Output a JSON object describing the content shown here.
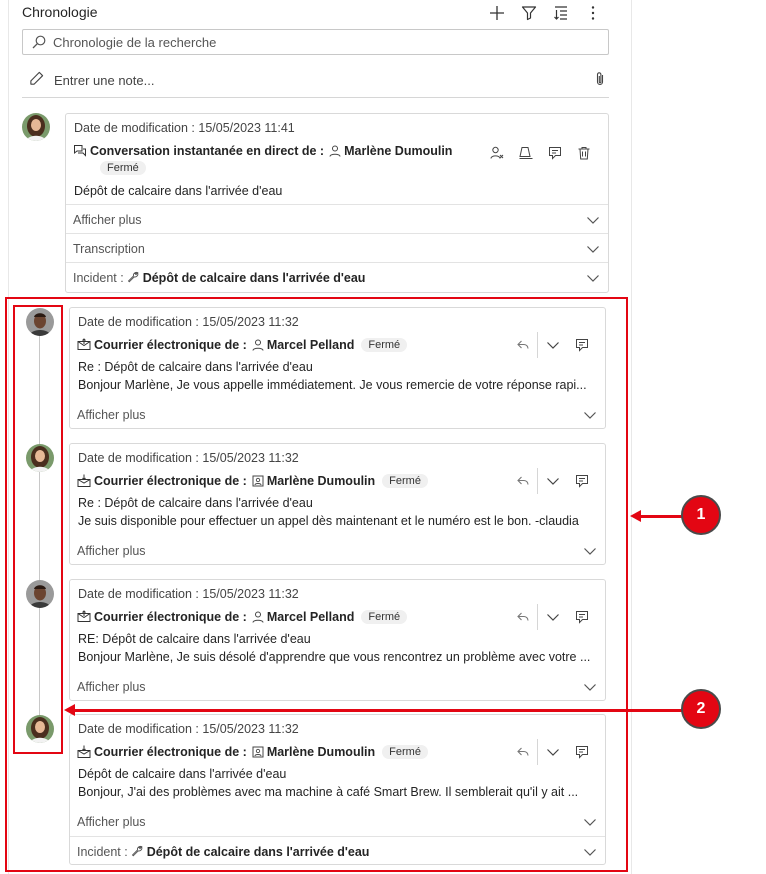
{
  "header": {
    "title": "Chronologie",
    "search_placeholder": "Chronologie de la recherche",
    "note_placeholder": "Entrer une note..."
  },
  "labels": {
    "show_more": "Afficher plus",
    "transcription": "Transcription",
    "incident_prefix": "Incident :",
    "closed": "Fermé"
  },
  "cards": [
    {
      "modified": "Date de modification : 15/05/2023 11:41",
      "type": "Conversation instantanée en direct de :",
      "person": "Marlène Dumoulin",
      "status": "Fermé",
      "line1": "Dépôt de calcaire dans l'arrivée d'eau",
      "incident": "Dépôt de calcaire dans l'arrivée d'eau"
    },
    {
      "modified": "Date de modification : 15/05/2023 11:32",
      "type": "Courrier électronique de :",
      "person": "Marcel Pelland",
      "status": "Fermé",
      "line1": "Re : Dépôt de calcaire dans l'arrivée d'eau",
      "line2": "Bonjour Marlène, Je vous appelle immédiatement. Je vous remercie de votre réponse rapi..."
    },
    {
      "modified": "Date de modification : 15/05/2023 11:32",
      "type": "Courrier électronique de :",
      "person": "Marlène Dumoulin",
      "status": "Fermé",
      "line1": "Re : Dépôt de calcaire dans l'arrivée d'eau",
      "line2": "Je suis disponible pour effectuer un appel dès maintenant et le numéro est le bon. -claudia"
    },
    {
      "modified": "Date de modification : 15/05/2023 11:32",
      "type": "Courrier électronique de :",
      "person": "Marcel Pelland",
      "status": "Fermé",
      "line1": "RE: Dépôt de calcaire dans l'arrivée d'eau",
      "line2": "Bonjour Marlène, Je suis désolé d'apprendre que vous rencontrez un problème avec votre ..."
    },
    {
      "modified": "Date de modification : 15/05/2023 11:32",
      "type": "Courrier électronique de :",
      "person": "Marlène Dumoulin",
      "status": "Fermé",
      "line1": "Dépôt de calcaire dans l'arrivée d'eau",
      "line2": "Bonjour, J'ai des problèmes avec ma machine à café Smart Brew. Il semblerait qu'il y ait ...",
      "incident": "Dépôt de calcaire dans l'arrivée d'eau"
    }
  ],
  "callouts": [
    "1",
    "2"
  ],
  "colors": {
    "annotation": "#e30613"
  },
  "icons": [
    "plus-icon",
    "filter-icon",
    "sort-icon",
    "more-icon",
    "search-icon",
    "pencil-icon",
    "paperclip-icon",
    "chat-icon",
    "email-received-icon",
    "email-sent-icon",
    "person-icon",
    "contact-icon",
    "assign-icon",
    "queue-icon",
    "note-icon",
    "delete-icon",
    "reply-icon",
    "chevron-down-icon",
    "wrench-icon"
  ]
}
